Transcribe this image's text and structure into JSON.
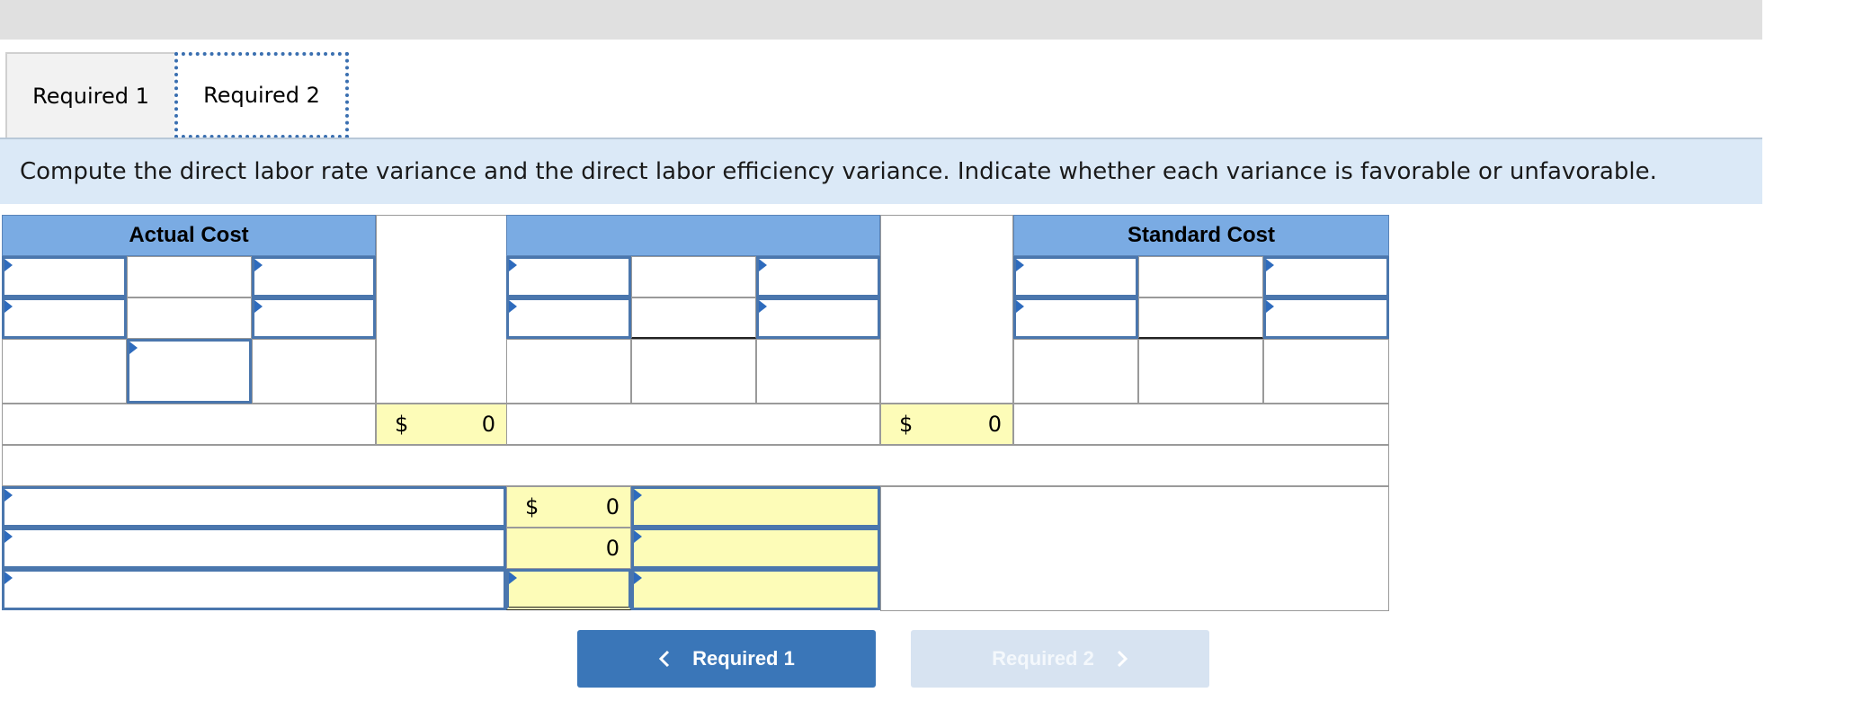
{
  "tabs": [
    {
      "label": "Required 1"
    },
    {
      "label": "Required 2"
    }
  ],
  "instruction": "Compute the direct labor rate variance and the direct labor efficiency variance. Indicate whether each variance is favorable or unfavorable.",
  "worksheet": {
    "actual_header": "Actual Cost",
    "middle_header": "",
    "standard_header": "Standard Cost",
    "actual_total": {
      "currency": "$",
      "value": "0"
    },
    "standard_total": {
      "currency": "$",
      "value": "0"
    },
    "variances": [
      {
        "currency": "$",
        "value": "0"
      },
      {
        "currency": "",
        "value": "0"
      },
      {
        "currency": "",
        "value": ""
      }
    ]
  },
  "nav": {
    "prev_label": "Required 1",
    "next_label": "Required 2"
  },
  "colors": {
    "header_blue": "#7aabe3",
    "input_border": "#4a76ad",
    "total_yellow": "#fdfcb8",
    "instruction_bg": "#dbe9f7",
    "primary_button": "#3a76b8",
    "disabled_button": "#d7e3f1"
  }
}
